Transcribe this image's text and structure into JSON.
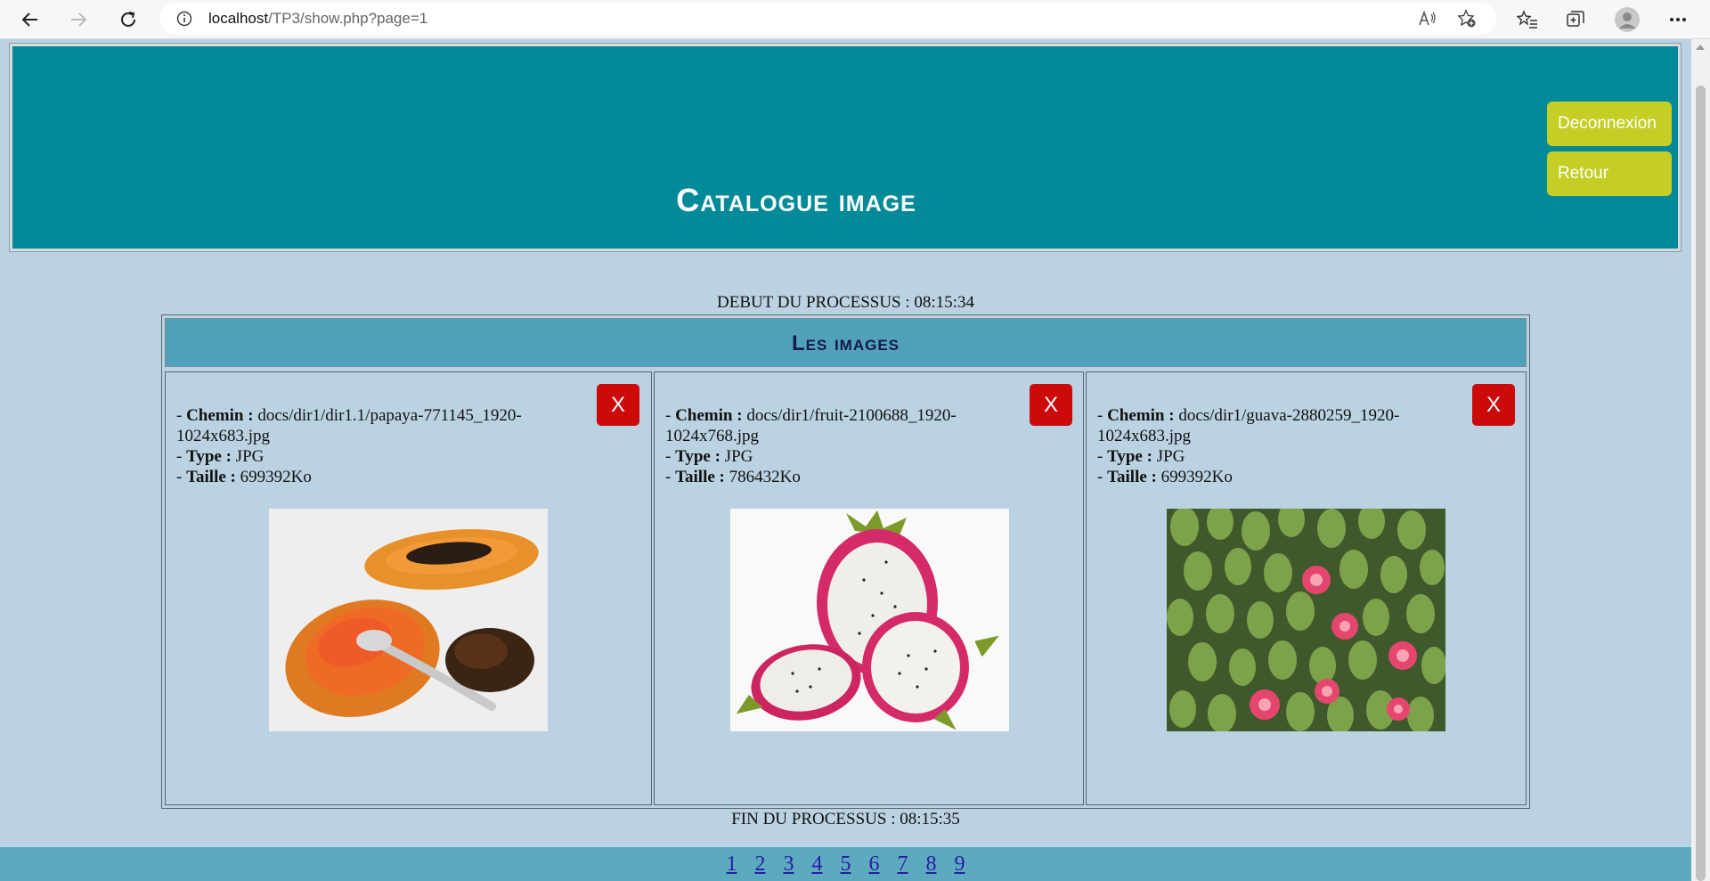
{
  "browser": {
    "url_host": "localhost",
    "url_path": "/TP3/show.php?page=1"
  },
  "header": {
    "title": "Catalogue image",
    "logout_label": "Deconnexion",
    "back_label": "Retour"
  },
  "process": {
    "start": "DEBUT DU PROCESSUS : 08:15:34",
    "end": "FIN DU PROCESSUS : 08:15:35"
  },
  "gallery": {
    "title": "Les images",
    "labels": {
      "path": "Chemin :",
      "type": "Type :",
      "size": "Taille :"
    },
    "delete_label": "X",
    "items": [
      {
        "path": "docs/dir1/dir1.1/papaya-771145_1920-1024x683.jpg",
        "type": "JPG",
        "size": "699392Ko",
        "image": "papaya"
      },
      {
        "path": "docs/dir1/fruit-2100688_1920-1024x768.jpg",
        "type": "JPG",
        "size": "786432Ko",
        "image": "dragon-fruit"
      },
      {
        "path": "docs/dir1/guava-2880259_1920-1024x683.jpg",
        "type": "JPG",
        "size": "699392Ko",
        "image": "guava"
      }
    ]
  },
  "pagination": [
    "1",
    "2",
    "3",
    "4",
    "5",
    "6",
    "7",
    "8",
    "9"
  ]
}
